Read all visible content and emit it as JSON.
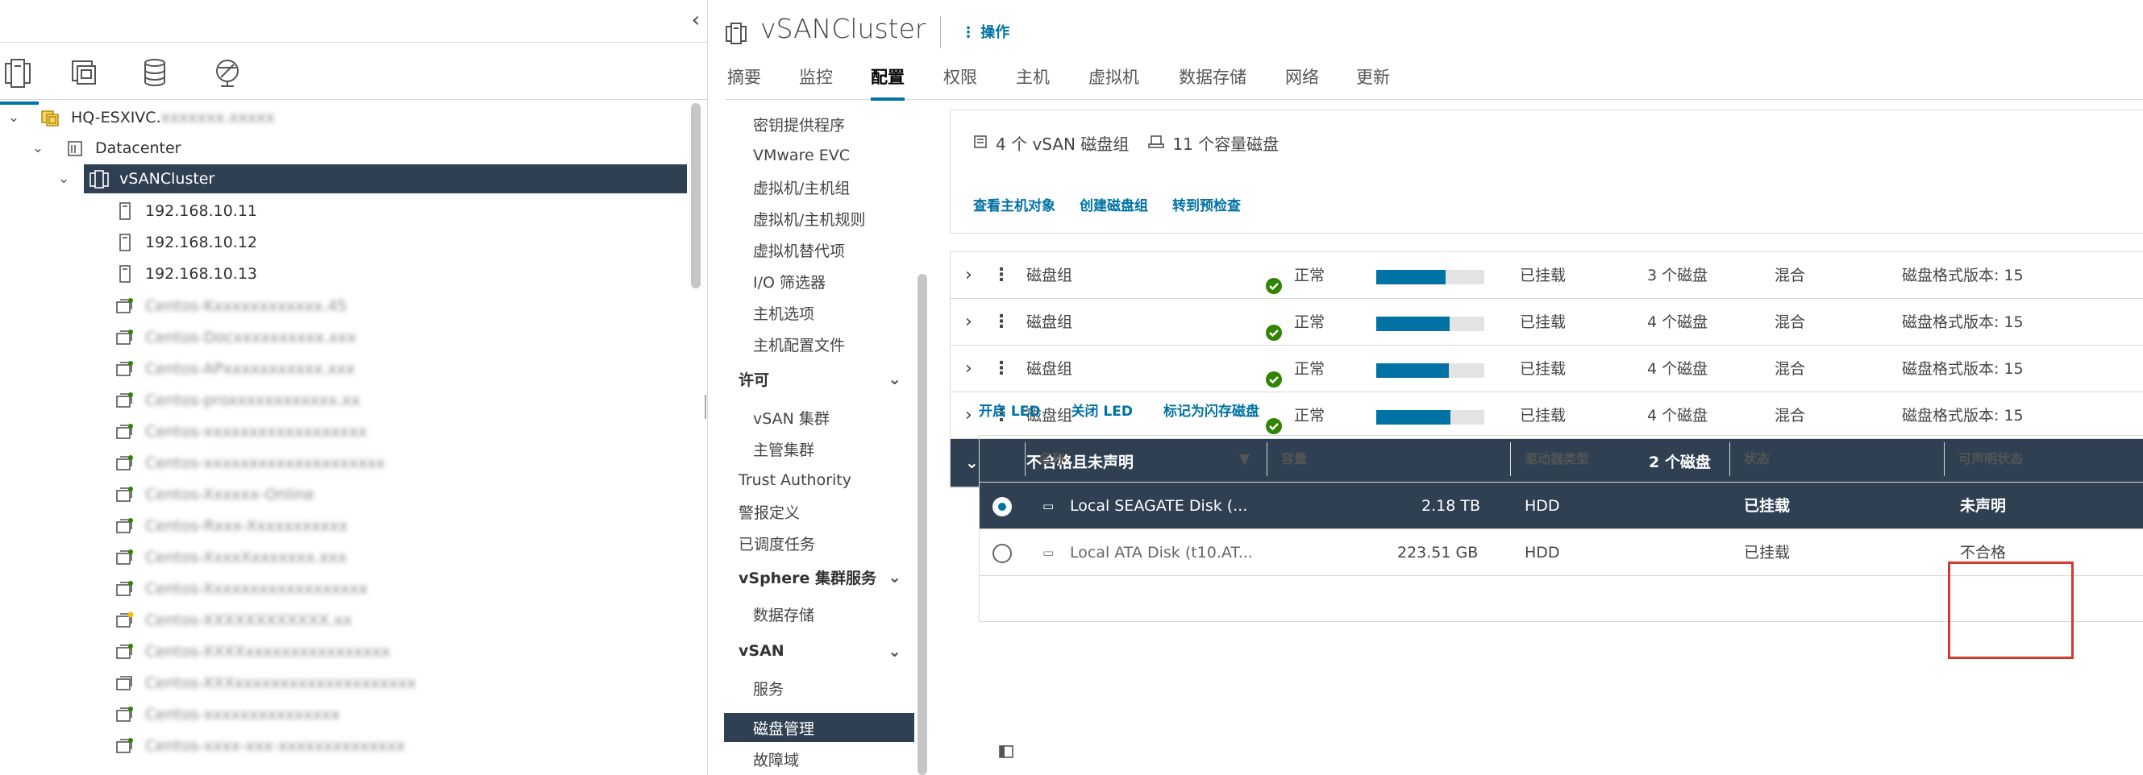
{
  "inventory_tabs": [
    {
      "name": "hosts-clusters",
      "icon": "hosts-clusters-icon",
      "active": true
    },
    {
      "name": "vms-templates",
      "icon": "vms-templates-icon",
      "active": false
    },
    {
      "name": "storage",
      "icon": "storage-icon",
      "active": false
    },
    {
      "name": "networking",
      "icon": "networking-icon",
      "active": false
    }
  ],
  "tree": [
    {
      "label": "HQ-ESXIVC.",
      "blurred_suffix": "xxxxxxx.xxxxx",
      "icon": "vcenter-icon",
      "indent": 0,
      "expanded": true
    },
    {
      "label": "Datacenter",
      "icon": "datacenter-icon",
      "indent": 1,
      "expanded": true
    },
    {
      "label": "vSANCluster",
      "icon": "cluster-icon",
      "indent": 2,
      "expanded": true,
      "selected": true
    },
    {
      "label": "192.168.10.11",
      "icon": "host-icon",
      "indent": 3
    },
    {
      "label": "192.168.10.12",
      "icon": "host-icon",
      "indent": 3
    },
    {
      "label": "192.168.10.13",
      "icon": "host-icon",
      "indent": 3
    },
    {
      "label": "Centos-Kxxxxxxxxxxxx.45",
      "icon": "vm-icon",
      "indent": 3,
      "blurred": true
    },
    {
      "label": "Centos-Docxxxxxxxxxx.xxx",
      "icon": "vm-icon",
      "indent": 3,
      "blurred": true
    },
    {
      "label": "Centos-APxxxxxxxxxxx.xxx",
      "icon": "vm-icon",
      "indent": 3,
      "blurred": true
    },
    {
      "label": "Centos-proxxxxxxxxxxxx.xx",
      "icon": "vm-icon",
      "indent": 3,
      "blurred": true
    },
    {
      "label": "Centos-xxxxxxxxxxxxxxxxxx",
      "icon": "vm-icon",
      "indent": 3,
      "blurred": true
    },
    {
      "label": "Centos-xxxxxxxxxxxxxxxxxxxx",
      "icon": "vm-icon",
      "indent": 3,
      "blurred": true
    },
    {
      "label": "Centos-Xxxxxx-Online",
      "icon": "vm-icon",
      "indent": 3,
      "blurred": true
    },
    {
      "label": "Centos-Rxxx-Xxxxxxxxxxx",
      "icon": "vm-icon",
      "indent": 3,
      "blurred": true
    },
    {
      "label": "Centos-XxxxXxxxxxxx.xxx",
      "icon": "vm-icon",
      "indent": 3,
      "blurred": true
    },
    {
      "label": "Centos-Xxxxxxxxxxxxxxxxxx",
      "icon": "vm-icon",
      "indent": 3,
      "blurred": true
    },
    {
      "label": "Centos-XXXXXXXXXXXX.xx",
      "icon": "vm-warning-icon",
      "indent": 3,
      "blurred": true
    },
    {
      "label": "Centos-XXXXxxxxxxxxxxxxxxxx",
      "icon": "vm-icon",
      "indent": 3,
      "blurred": true
    },
    {
      "label": "Centos-XXXxxxxxxxxxxxxxxxxxxxx",
      "icon": "vm-icon",
      "indent": 3,
      "blurred": true
    },
    {
      "label": "Centos-xxxxxxxxxxxxxxx",
      "icon": "vm-icon",
      "indent": 3,
      "blurred": true
    },
    {
      "label": "Centos-xxxx-xxx-xxxxxxxxxxxxxx",
      "icon": "vm-icon",
      "indent": 3,
      "blurred": true
    }
  ],
  "header": {
    "title": "vSANCluster",
    "actions_label": "操作"
  },
  "tabs": [
    {
      "label": "摘要",
      "active": false
    },
    {
      "label": "监控",
      "active": false
    },
    {
      "label": "配置",
      "active": true
    },
    {
      "label": "权限",
      "active": false
    },
    {
      "label": "主机",
      "active": false
    },
    {
      "label": "虚拟机",
      "active": false
    },
    {
      "label": "数据存储",
      "active": false
    },
    {
      "label": "网络",
      "active": false
    },
    {
      "label": "更新",
      "active": false
    }
  ],
  "config_nav": [
    {
      "label": "密钥提供程序",
      "kind": "sub"
    },
    {
      "label": "VMware EVC",
      "kind": "sub"
    },
    {
      "label": "虚拟机/主机组",
      "kind": "sub"
    },
    {
      "label": "虚拟机/主机规则",
      "kind": "sub"
    },
    {
      "label": "虚拟机替代项",
      "kind": "sub"
    },
    {
      "label": "I/O 筛选器",
      "kind": "sub"
    },
    {
      "label": "主机选项",
      "kind": "sub"
    },
    {
      "label": "主机配置文件",
      "kind": "sub"
    },
    {
      "label": "许可",
      "kind": "grp"
    },
    {
      "label": "vSAN 集群",
      "kind": "sub"
    },
    {
      "label": "主管集群",
      "kind": "sub"
    },
    {
      "label": "Trust Authority",
      "kind": "top"
    },
    {
      "label": "警报定义",
      "kind": "top"
    },
    {
      "label": "已调度任务",
      "kind": "top"
    },
    {
      "label": "vSphere 集群服务",
      "kind": "grp"
    },
    {
      "label": "数据存储",
      "kind": "sub"
    },
    {
      "label": "vSAN",
      "kind": "grp"
    },
    {
      "label": "服务",
      "kind": "sub"
    },
    {
      "label": "磁盘管理",
      "kind": "sub",
      "selected": true
    },
    {
      "label": "故障域",
      "kind": "sub"
    }
  ],
  "summary": {
    "disk_groups": "4 个 vSAN 磁盘组",
    "capacity_disks": "11 个容量磁盘",
    "links": [
      "查看主机对象",
      "创建磁盘组",
      "转到预检查"
    ]
  },
  "disk_groups": [
    {
      "name": "磁盘组",
      "status": "正常",
      "usage": 0.64,
      "mount": "已挂载",
      "disks": "3 个磁盘",
      "type": "混合",
      "format": "磁盘格式版本: 15"
    },
    {
      "name": "磁盘组",
      "status": "正常",
      "usage": 0.68,
      "mount": "已挂载",
      "disks": "4 个磁盘",
      "type": "混合",
      "format": "磁盘格式版本: 15"
    },
    {
      "name": "磁盘组",
      "status": "正常",
      "usage": 0.67,
      "mount": "已挂载",
      "disks": "4 个磁盘",
      "type": "混合",
      "format": "磁盘格式版本: 15"
    },
    {
      "name": "磁盘组",
      "status": "正常",
      "usage": 0.69,
      "mount": "已挂载",
      "disks": "4 个磁盘",
      "type": "混合",
      "format": "磁盘格式版本: 15"
    }
  ],
  "unclaimed_group": {
    "name": "不合格且未声明",
    "disks": "2 个磁盘"
  },
  "detail_links": [
    "开启 LED",
    "关闭 LED",
    "标记为闪存磁盘"
  ],
  "disk_table": {
    "columns": [
      "名称",
      "容量",
      "驱动器类型",
      "状态",
      "可声明状态"
    ],
    "rows": [
      {
        "name": "Local SEAGATE Disk (...",
        "capacity": "2.18 TB",
        "drive": "HDD",
        "state": "已挂载",
        "claim": "未声明",
        "selected": true
      },
      {
        "name": "Local ATA Disk (t10.AT...",
        "capacity": "223.51 GB",
        "drive": "HDD",
        "state": "已挂载",
        "claim": "不合格",
        "selected": false
      }
    ]
  },
  "colors": {
    "accent": "#0072a3",
    "selected_bg": "#2e4052",
    "ok_green": "#2f8400",
    "highlight": "#d23b2e"
  }
}
